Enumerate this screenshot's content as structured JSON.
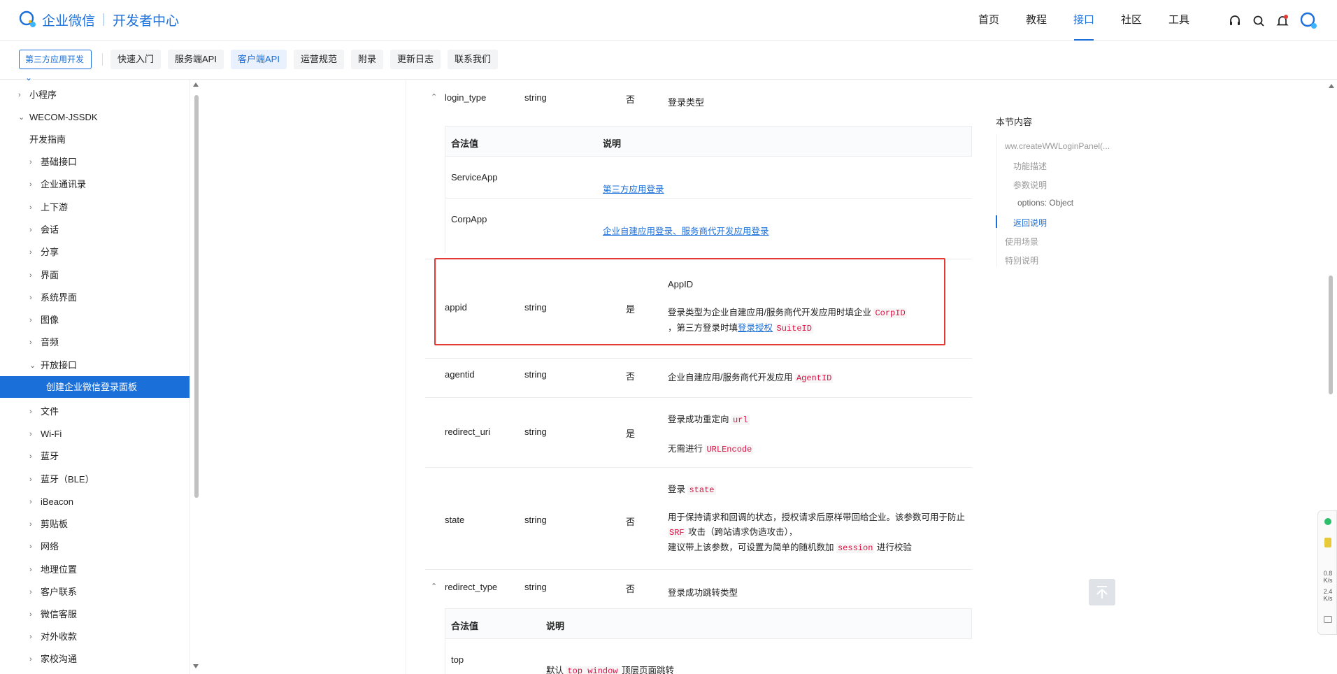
{
  "header": {
    "brand": "企业微信",
    "sub": "开发者中心",
    "nav": [
      "首页",
      "教程",
      "接口",
      "社区",
      "工具"
    ],
    "active_nav": "接口"
  },
  "subbar": {
    "category": "第三方应用开发",
    "tabs": [
      "快速入门",
      "服务端API",
      "客户端API",
      "运营规范",
      "附录",
      "更新日志",
      "联系我们"
    ],
    "active_tab": "客户端API"
  },
  "sidebar": {
    "items": [
      {
        "label": "小程序",
        "level": 1,
        "chev": "›"
      },
      {
        "label": "WECOM-JSSDK",
        "level": 1,
        "chev": "⌄"
      },
      {
        "label": "开发指南",
        "level": 2,
        "chev": ""
      },
      {
        "label": "基础接口",
        "level": 2,
        "chev": "›"
      },
      {
        "label": "企业通讯录",
        "level": 2,
        "chev": "›"
      },
      {
        "label": "上下游",
        "level": 2,
        "chev": "›"
      },
      {
        "label": "会话",
        "level": 2,
        "chev": "›"
      },
      {
        "label": "分享",
        "level": 2,
        "chev": "›"
      },
      {
        "label": "界面",
        "level": 2,
        "chev": "›"
      },
      {
        "label": "系统界面",
        "level": 2,
        "chev": "›"
      },
      {
        "label": "图像",
        "level": 2,
        "chev": "›"
      },
      {
        "label": "音频",
        "level": 2,
        "chev": "›"
      },
      {
        "label": "开放接口",
        "level": 2,
        "chev": "⌄"
      },
      {
        "label": "创建企业微信登录面板",
        "level": 3,
        "chev": "",
        "active": true
      },
      {
        "label": "文件",
        "level": 2,
        "chev": "›"
      },
      {
        "label": "Wi-Fi",
        "level": 2,
        "chev": "›"
      },
      {
        "label": "蓝牙",
        "level": 2,
        "chev": "›"
      },
      {
        "label": "蓝牙（BLE）",
        "level": 2,
        "chev": "›"
      },
      {
        "label": "iBeacon",
        "level": 2,
        "chev": "›"
      },
      {
        "label": "剪贴板",
        "level": 2,
        "chev": "›"
      },
      {
        "label": "网络",
        "level": 2,
        "chev": "›"
      },
      {
        "label": "地理位置",
        "level": 2,
        "chev": "›"
      },
      {
        "label": "客户联系",
        "level": 2,
        "chev": "›"
      },
      {
        "label": "微信客服",
        "level": 2,
        "chev": "›"
      },
      {
        "label": "对外收款",
        "level": 2,
        "chev": "›"
      },
      {
        "label": "家校沟通",
        "level": 2,
        "chev": "›"
      }
    ]
  },
  "params": {
    "login_type": {
      "name": "login_type",
      "type": "string",
      "required": "否",
      "desc": "登录类型"
    },
    "sub1": {
      "h1": "合法值",
      "h2": "说明",
      "r1_key": "ServiceApp",
      "r1_val": "第三方应用登录",
      "r2_key": "CorpApp",
      "r2_val_a": "企业自建应用登录",
      "r2_sep": "、",
      "r2_val_b": "服务商代开发应用登录"
    },
    "appid": {
      "name": "appid",
      "type": "string",
      "required": "是",
      "title": "AppID",
      "desc_a": "登录类型为企业自建应用/服务商代开发应用时填企业 ",
      "code_a": "CorpID",
      "desc_b": "，第三方登录时填",
      "link": "登录授权",
      "code_b": "SuiteID"
    },
    "agentid": {
      "name": "agentid",
      "type": "string",
      "required": "否",
      "desc": "企业自建应用/服务商代开发应用 ",
      "code": "AgentID"
    },
    "redirect_uri": {
      "name": "redirect_uri",
      "type": "string",
      "required": "是",
      "desc_a": "登录成功重定向 ",
      "code_a": "url",
      "desc_b": "无需进行 ",
      "code_b": "URLEncode"
    },
    "state": {
      "name": "state",
      "type": "string",
      "required": "否",
      "desc_a": "登录 ",
      "code_a": "state",
      "desc_b": "用于保持请求和回调的状态，授权请求后原样带回给企业。该参数可用于防止 ",
      "code_b": "SRF",
      "desc_c": " 攻击（跨站请求伪造攻击），",
      "desc_d": "建议带上该参数，可设置为简单的随机数加 ",
      "code_c": "session",
      "desc_e": " 进行校验"
    },
    "redirect_type": {
      "name": "redirect_type",
      "type": "string",
      "required": "否",
      "desc": "登录成功跳转类型"
    },
    "sub2": {
      "h1": "合法值",
      "h2": "说明",
      "r1_key": "top",
      "r1_a": "默认 ",
      "r1_code": "top window",
      "r1_b": " 顶层页面跳转"
    }
  },
  "toc": {
    "title": "本节内容",
    "items": [
      "ww.createWWLoginPanel(...",
      "功能描述",
      "参数说明",
      "options: Object",
      "返回说明",
      "使用场景",
      "特别说明"
    ],
    "active": "返回说明"
  },
  "widget": {
    "up": "0.8",
    "up_unit": "K/s",
    "down": "2.4",
    "down_unit": "K/s"
  },
  "colors": {
    "accent": "#1b6fd9",
    "highlight_border": "#e53935",
    "code": "#dd1144"
  }
}
